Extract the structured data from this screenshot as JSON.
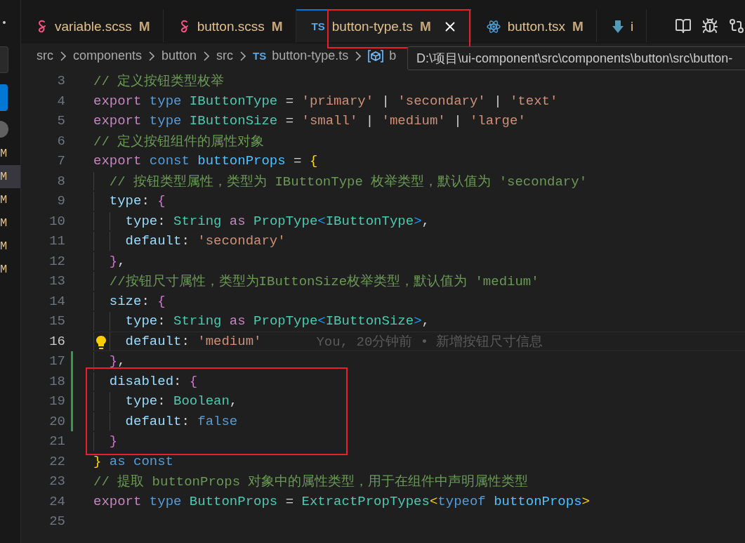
{
  "sidebar": {
    "items": [
      {
        "label": "M",
        "selected": false
      },
      {
        "label": "M",
        "selected": true
      },
      {
        "label": "M",
        "selected": false
      },
      {
        "label": "M",
        "selected": false
      },
      {
        "label": "M",
        "selected": false
      },
      {
        "label": "M",
        "selected": false
      }
    ]
  },
  "tabs": [
    {
      "label": "variable.scss",
      "kind": "sass",
      "status": "M",
      "selected": false,
      "framed": false
    },
    {
      "label": "button.scss",
      "kind": "sass",
      "status": "M",
      "selected": false,
      "framed": false
    },
    {
      "label": "button-type.ts",
      "kind": "ts",
      "icon_label": "TS",
      "status": "M",
      "selected": true,
      "framed": true
    },
    {
      "label": "button.tsx",
      "kind": "react",
      "status": "M",
      "selected": false,
      "framed": false
    },
    {
      "label": "i",
      "kind": "download",
      "selected": false,
      "framed": false
    }
  ],
  "breadcrumb": [
    {
      "label": "src",
      "kind": "folder"
    },
    {
      "label": "components",
      "kind": "folder"
    },
    {
      "label": "button",
      "kind": "folder"
    },
    {
      "label": "src",
      "kind": "folder"
    },
    {
      "label": "button-type.ts",
      "kind": "ts",
      "icon_label": "TS"
    },
    {
      "label": "b",
      "kind": "symbol"
    }
  ],
  "tooltip": "D:\\项目\\ui-component\\src\\components\\button\\src\\button-",
  "editor": {
    "lines": [
      {
        "number": "3",
        "current": false,
        "added": false,
        "framed": false,
        "lightbulb": false,
        "tokens": [
          {
            "kind": "com",
            "text": "// 定义按钮类型枚举"
          }
        ]
      },
      {
        "number": "4",
        "current": false,
        "added": false,
        "framed": false,
        "lightbulb": false,
        "tokens": [
          {
            "kind": "kw",
            "text": "export "
          },
          {
            "kind": "st",
            "text": "type "
          },
          {
            "kind": "ty",
            "text": "IButtonType"
          },
          {
            "kind": "p",
            "text": " = "
          },
          {
            "kind": "s",
            "text": "'primary'"
          },
          {
            "kind": "p",
            "text": " | "
          },
          {
            "kind": "s",
            "text": "'secondary'"
          },
          {
            "kind": "p",
            "text": " | "
          },
          {
            "kind": "s",
            "text": "'text'"
          }
        ]
      },
      {
        "number": "5",
        "current": false,
        "added": false,
        "framed": false,
        "lightbulb": false,
        "tokens": [
          {
            "kind": "kw",
            "text": "export "
          },
          {
            "kind": "st",
            "text": "type "
          },
          {
            "kind": "ty",
            "text": "IButtonSize"
          },
          {
            "kind": "p",
            "text": " = "
          },
          {
            "kind": "s",
            "text": "'small'"
          },
          {
            "kind": "p",
            "text": " | "
          },
          {
            "kind": "s",
            "text": "'medium'"
          },
          {
            "kind": "p",
            "text": " | "
          },
          {
            "kind": "s",
            "text": "'large'"
          }
        ]
      },
      {
        "number": "6",
        "current": false,
        "added": false,
        "framed": false,
        "lightbulb": false,
        "tokens": [
          {
            "kind": "com",
            "text": "// 定义按钮组件的属性对象"
          }
        ]
      },
      {
        "number": "7",
        "current": false,
        "added": false,
        "framed": false,
        "lightbulb": false,
        "tokens": [
          {
            "kind": "kw",
            "text": "export "
          },
          {
            "kind": "st",
            "text": "const "
          },
          {
            "kind": "v",
            "text": "buttonProps"
          },
          {
            "kind": "p",
            "text": " = "
          },
          {
            "kind": "b1",
            "text": "{"
          }
        ]
      },
      {
        "number": "8",
        "current": false,
        "added": false,
        "framed": false,
        "lightbulb": false,
        "tokens": [
          {
            "kind": "com",
            "text": "  // 按钮类型属性，类型为 IButtonType 枚举类型，默认值为 'secondary'"
          }
        ]
      },
      {
        "number": "9",
        "current": false,
        "added": false,
        "framed": false,
        "lightbulb": false,
        "tokens": [
          {
            "kind": "pr",
            "text": "  type"
          },
          {
            "kind": "p",
            "text": ": "
          },
          {
            "kind": "b2",
            "text": "{"
          }
        ]
      },
      {
        "number": "10",
        "current": false,
        "added": false,
        "framed": false,
        "lightbulb": false,
        "tokens": [
          {
            "kind": "pr",
            "text": "    type"
          },
          {
            "kind": "p",
            "text": ": "
          },
          {
            "kind": "ty",
            "text": "String "
          },
          {
            "kind": "kw",
            "text": "as "
          },
          {
            "kind": "ty",
            "text": "PropType"
          },
          {
            "kind": "b3",
            "text": "<"
          },
          {
            "kind": "ty",
            "text": "IButtonType"
          },
          {
            "kind": "b3",
            "text": ">"
          },
          {
            "kind": "p",
            "text": ","
          }
        ]
      },
      {
        "number": "11",
        "current": false,
        "added": false,
        "framed": false,
        "lightbulb": false,
        "tokens": [
          {
            "kind": "pr",
            "text": "    default"
          },
          {
            "kind": "p",
            "text": ": "
          },
          {
            "kind": "s",
            "text": "'secondary'"
          }
        ]
      },
      {
        "number": "12",
        "current": false,
        "added": false,
        "framed": false,
        "lightbulb": false,
        "tokens": [
          {
            "kind": "b2",
            "text": "  }"
          },
          {
            "kind": "p",
            "text": ","
          }
        ]
      },
      {
        "number": "13",
        "current": false,
        "added": false,
        "framed": false,
        "lightbulb": false,
        "tokens": [
          {
            "kind": "com",
            "text": "  //按钮尺寸属性，类型为IButtonSize枚举类型，默认值为 'medium'"
          }
        ]
      },
      {
        "number": "14",
        "current": false,
        "added": false,
        "framed": false,
        "lightbulb": false,
        "tokens": [
          {
            "kind": "pr",
            "text": "  size"
          },
          {
            "kind": "p",
            "text": ": "
          },
          {
            "kind": "b2",
            "text": "{"
          }
        ]
      },
      {
        "number": "15",
        "current": false,
        "added": false,
        "framed": false,
        "lightbulb": false,
        "tokens": [
          {
            "kind": "pr",
            "text": "    type"
          },
          {
            "kind": "p",
            "text": ": "
          },
          {
            "kind": "ty",
            "text": "String "
          },
          {
            "kind": "kw",
            "text": "as "
          },
          {
            "kind": "ty",
            "text": "PropType"
          },
          {
            "kind": "b3",
            "text": "<"
          },
          {
            "kind": "ty",
            "text": "IButtonSize"
          },
          {
            "kind": "b3",
            "text": ">"
          },
          {
            "kind": "p",
            "text": ","
          }
        ]
      },
      {
        "number": "16",
        "current": true,
        "added": false,
        "framed": false,
        "lightbulb": true,
        "blame": "You, 20分钟前 • 新增按钮尺寸信息",
        "tokens": [
          {
            "kind": "pr",
            "text": "    default"
          },
          {
            "kind": "p",
            "text": ": "
          },
          {
            "kind": "s",
            "text": "'medium'"
          }
        ]
      },
      {
        "number": "17",
        "current": false,
        "added": true,
        "framed": false,
        "lightbulb": false,
        "tokens": [
          {
            "kind": "b2",
            "text": "  }"
          },
          {
            "kind": "p",
            "text": ","
          }
        ]
      },
      {
        "number": "18",
        "current": false,
        "added": true,
        "framed": true,
        "lightbulb": false,
        "tokens": [
          {
            "kind": "pr",
            "text": "  disabled"
          },
          {
            "kind": "p",
            "text": ": "
          },
          {
            "kind": "b2",
            "text": "{"
          }
        ]
      },
      {
        "number": "19",
        "current": false,
        "added": true,
        "framed": true,
        "lightbulb": false,
        "tokens": [
          {
            "kind": "pr",
            "text": "    type"
          },
          {
            "kind": "p",
            "text": ": "
          },
          {
            "kind": "ty",
            "text": "Boolean"
          },
          {
            "kind": "p",
            "text": ","
          }
        ]
      },
      {
        "number": "20",
        "current": false,
        "added": true,
        "framed": true,
        "lightbulb": false,
        "tokens": [
          {
            "kind": "pr",
            "text": "    default"
          },
          {
            "kind": "p",
            "text": ": "
          },
          {
            "kind": "st",
            "text": "false"
          }
        ]
      },
      {
        "number": "21",
        "current": false,
        "added": false,
        "framed": true,
        "lightbulb": false,
        "tokens": [
          {
            "kind": "b2",
            "text": "  }"
          }
        ]
      },
      {
        "number": "22",
        "current": false,
        "added": false,
        "framed": false,
        "lightbulb": false,
        "tokens": [
          {
            "kind": "b1",
            "text": "}"
          },
          {
            "kind": "st",
            "text": " as const"
          }
        ]
      },
      {
        "number": "23",
        "current": false,
        "added": false,
        "framed": false,
        "lightbulb": false,
        "tokens": [
          {
            "kind": "com",
            "text": "// 提取 buttonProps 对象中的属性类型，用于在组件中声明属性类型"
          }
        ]
      },
      {
        "number": "24",
        "current": false,
        "added": false,
        "framed": false,
        "lightbulb": false,
        "tokens": [
          {
            "kind": "kw",
            "text": "export "
          },
          {
            "kind": "st",
            "text": "type "
          },
          {
            "kind": "ty",
            "text": "ButtonProps"
          },
          {
            "kind": "p",
            "text": " = "
          },
          {
            "kind": "ty",
            "text": "ExtractPropTypes"
          },
          {
            "kind": "b1",
            "text": "<"
          },
          {
            "kind": "st",
            "text": "typeof "
          },
          {
            "kind": "v",
            "text": "buttonProps"
          },
          {
            "kind": "b1",
            "text": ">"
          }
        ]
      },
      {
        "number": "25",
        "current": false,
        "added": false,
        "framed": false,
        "lightbulb": false
      }
    ]
  }
}
